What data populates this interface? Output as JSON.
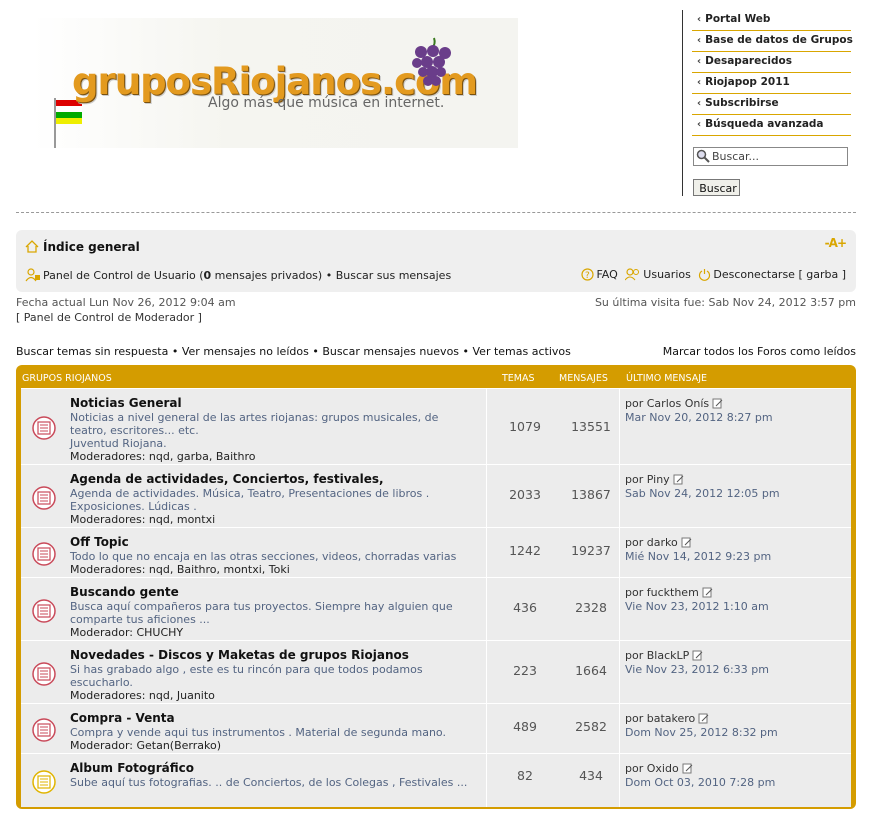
{
  "header": {
    "logo_text": "gruposRiojanos.com",
    "slogan": "Algo más que música en internet.",
    "side_links": [
      "Portal Web",
      "Base de datos de Grupos",
      "Desaparecidos",
      "Riojapop 2011",
      "Subscribirse",
      "Búsqueda avanzada"
    ],
    "search_placeholder": "Buscar...",
    "search_button": "Buscar"
  },
  "navbar": {
    "home": "Índice general",
    "font_size": "-A+",
    "ucp_label": "Panel de Control de Usuario",
    "ucp_paren_open": " (",
    "pm_count": "0",
    "pm_label": " mensajes privados) • ",
    "own_posts": "Buscar sus mensajes",
    "faq": "FAQ",
    "members": "Usuarios",
    "logout": "Desconectarse [ garba ]"
  },
  "info": {
    "current_date": "Fecha actual Lun Nov 26, 2012 9:04 am",
    "mod_panel": "[ Panel de Control de Moderador ]",
    "last_visit": "Su última visita fue: Sab Nov 24, 2012 3:57 pm"
  },
  "search_links": {
    "unanswered": "Buscar temas sin respuesta",
    "unread": "Ver mensajes no leídos",
    "new_posts": "Buscar mensajes nuevos",
    "active": "Ver temas activos",
    "separator": " • ",
    "mark_read": "Marcar todos los Foros como leídos"
  },
  "forum": {
    "headers": {
      "category": "GRUPOS RIOJANOS",
      "topics": "TEMAS",
      "posts": "MENSAJES",
      "last": "ÚLTIMO MENSAJE"
    },
    "last_by": "por",
    "rows": [
      {
        "title": "Noticias General",
        "desc": "Noticias a nivel general de las artes riojanas: grupos musicales, de teatro, escritores... etc.",
        "desc2": "Juventud Riojana.",
        "mods": "Moderadores: nqd, garba, Baithro",
        "topics": "1079",
        "posts": "13551",
        "last_user": "Carlos Onís",
        "last_date": "Mar Nov 20, 2012 8:27 pm",
        "icon": "unread"
      },
      {
        "title": "Agenda de actividades, Conciertos, festivales,",
        "desc": "Agenda de actividades. Música, Teatro, Presentaciones de libros . Exposiciones. Lúdicas .",
        "desc2": "",
        "mods": "Moderadores: nqd, montxi",
        "topics": "2033",
        "posts": "13867",
        "last_user": "Piny",
        "last_date": "Sab Nov 24, 2012 12:05 pm",
        "icon": "unread"
      },
      {
        "title": "Off Topic",
        "desc": "Todo lo que no encaja en las otras secciones, videos, chorradas varias",
        "desc2": "",
        "mods": "Moderadores: nqd, Baithro, montxi, Toki",
        "topics": "1242",
        "posts": "19237",
        "last_user": "darko",
        "last_date": "Mié Nov 14, 2012 9:23 pm",
        "icon": "unread"
      },
      {
        "title": "Buscando gente",
        "desc": "Busca aquí compañeros para tus proyectos. Siempre hay alguien que comparte tus aficiones ...",
        "desc2": "",
        "mods": "Moderador: CHUCHY",
        "topics": "436",
        "posts": "2328",
        "last_user": "fuckthem",
        "last_date": "Vie Nov 23, 2012 1:10 am",
        "icon": "unread"
      },
      {
        "title": "Novedades - Discos y Maketas de grupos Riojanos",
        "desc": "Si has grabado algo , este es tu rincón para que todos podamos escucharlo.",
        "desc2": "",
        "mods": "Moderadores: nqd, Juanito",
        "topics": "223",
        "posts": "1664",
        "last_user": "BlackLP",
        "last_date": "Vie Nov 23, 2012 6:33 pm",
        "icon": "unread"
      },
      {
        "title": "Compra - Venta",
        "desc": "Compra y vende aqui tus instrumentos . Material de segunda mano.",
        "desc2": "",
        "mods": "Moderador: Getan(Berrako)",
        "topics": "489",
        "posts": "2582",
        "last_user": "batakero",
        "last_date": "Dom Nov 25, 2012 8:32 pm",
        "icon": "unread"
      },
      {
        "title": "Album Fotográfico",
        "desc": "Sube aquí tus fotografias. .. de Conciertos, de los Colegas , Festivales ...",
        "desc2": "",
        "mods": "",
        "topics": "82",
        "posts": "434",
        "last_user": "Oxido",
        "last_date": "Dom Oct 03, 2010 7:28 pm",
        "icon": "read"
      }
    ]
  }
}
